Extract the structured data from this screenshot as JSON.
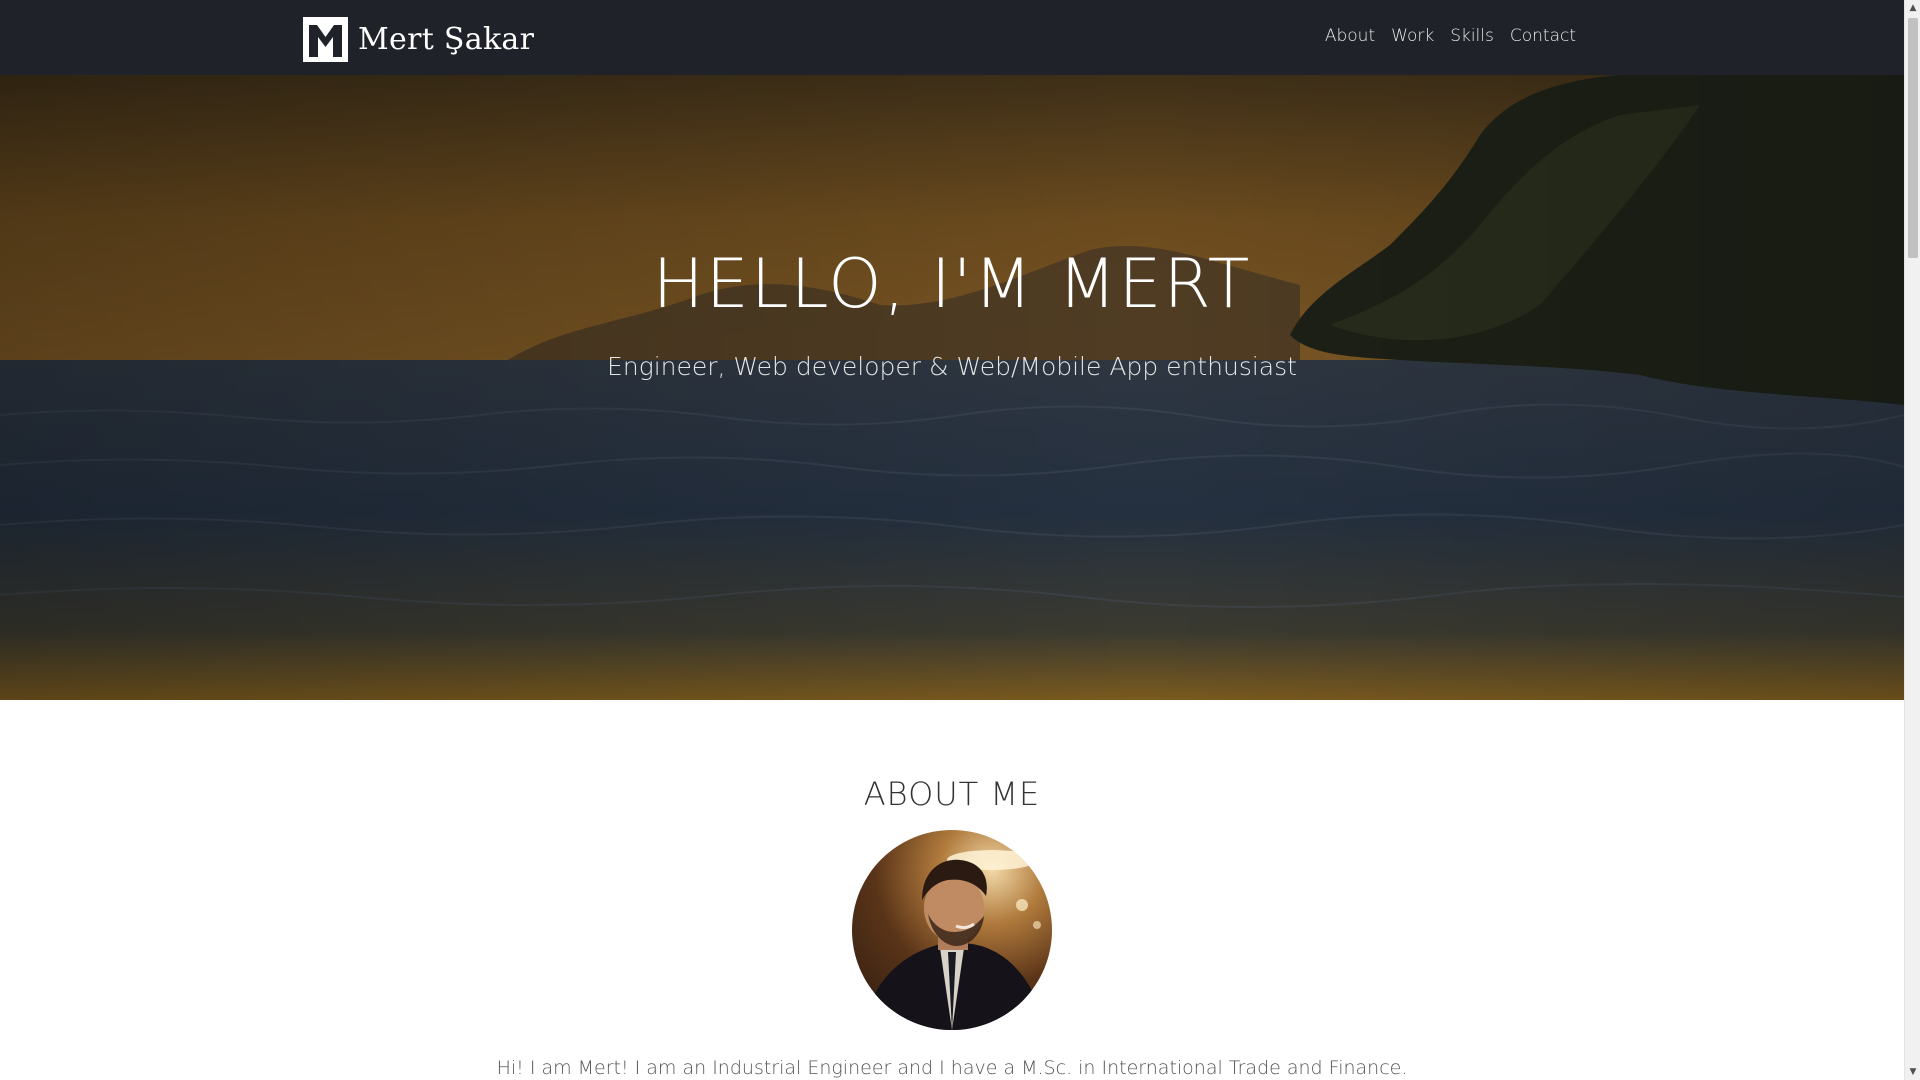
{
  "navbar": {
    "brand_name": "Mert Şakar",
    "links": [
      {
        "label": "About"
      },
      {
        "label": "Work"
      },
      {
        "label": "Skills"
      },
      {
        "label": "Contact"
      }
    ]
  },
  "hero": {
    "title": "HELLO, I'M MERT",
    "subtitle": "Engineer, Web developer & Web/Mobile App enthusiast"
  },
  "about": {
    "title": "ABOUT ME",
    "intro": "Hi! I am Mert! I am an Industrial Engineer and I have a M.Sc. in International Trade and Finance."
  },
  "colors": {
    "navbar_bg": "#1f2329",
    "hero_tint": "#6a4a1c",
    "heading_text": "#333333"
  },
  "icons": {
    "logo": "m-monogram-logo",
    "scroll_up": "triangle-up-icon",
    "scroll_down": "triangle-down-icon"
  }
}
